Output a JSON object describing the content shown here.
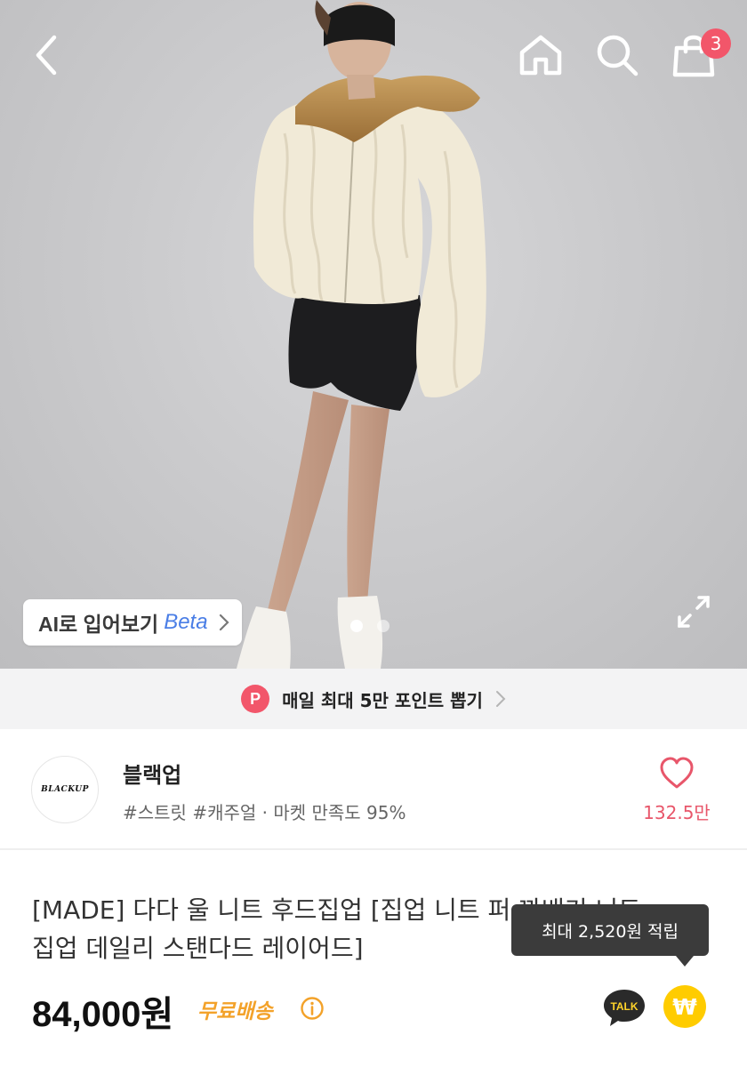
{
  "header": {
    "cart_count": "3"
  },
  "hero": {
    "ai_try_on_label": "AI로 입어보기",
    "ai_try_on_badge": "Beta",
    "slide_count": 2,
    "active_slide": 1
  },
  "point_banner": {
    "icon_letter": "P",
    "text": "매일 최대 5만 포인트 뽑기"
  },
  "shop": {
    "logo_text": "BLACKUP",
    "name": "블랙업",
    "tags": "#스트릿 #캐주얼 · 마켓 만족도 95%",
    "like_count": "132.5만"
  },
  "product": {
    "title_line1": "[MADE] 다다 울 니트 후드집업 [집업 니트 퍼 꽈배기 니트",
    "title_line2": "집업 데일리 스탠다드 레이어드]",
    "price": "84,000원",
    "shipping": "무료배송",
    "reward_tooltip": "최대 2,520원 적립",
    "talk_label": "TALK",
    "won_symbol": "₩"
  },
  "colors": {
    "accent_pink": "#f2566a",
    "shipping_orange": "#f3a22a",
    "beta_blue": "#4a7ee6",
    "won_yellow": "#ffcc00"
  },
  "icons": [
    "back-arrow-icon",
    "home-icon",
    "search-icon",
    "shopping-bag-icon",
    "chevron-right-icon",
    "expand-icon",
    "heart-icon",
    "info-icon",
    "kakao-talk-icon",
    "won-coin-icon"
  ]
}
